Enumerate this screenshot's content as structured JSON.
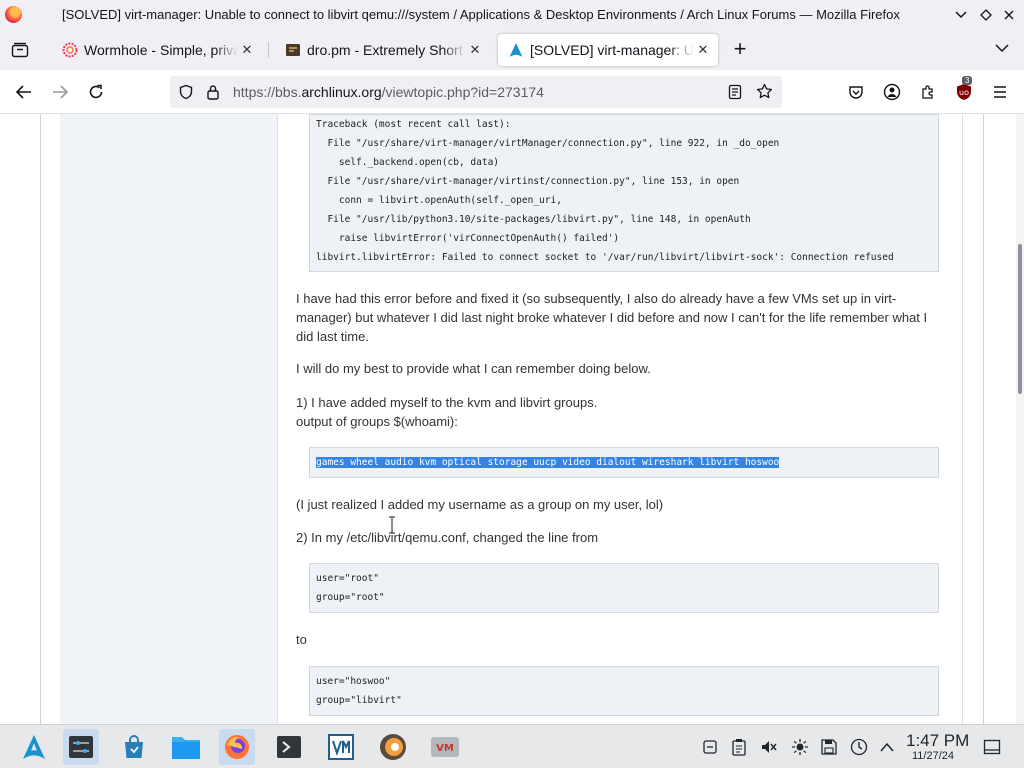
{
  "window": {
    "title": "[SOLVED] virt-manager: Unable to connect to libvirt qemu:///system / Applications & Desktop Environments / Arch Linux Forums — Mozilla Firefox"
  },
  "tabs": [
    {
      "label": "Wormhole - Simple, private file sharing",
      "favicon": "wormhole-icon",
      "active": false
    },
    {
      "label": "dro.pm - Extremely Short URL",
      "favicon": "dropm-icon",
      "active": false
    },
    {
      "label": "[SOLVED] virt-manager: Unable to connect",
      "favicon": "arch-icon",
      "active": true
    }
  ],
  "navbar": {
    "url_prefix": "https://bbs.",
    "url_domain": "archlinux.org",
    "url_path": "/viewtopic.php?id=273174",
    "extension_badge": "3"
  },
  "post": {
    "traceback": "Traceback (most recent call last):\n  File \"/usr/share/virt-manager/virtManager/connection.py\", line 922, in _do_open\n    self._backend.open(cb, data)\n  File \"/usr/share/virt-manager/virtinst/connection.py\", line 153, in open\n    conn = libvirt.openAuth(self._open_uri,\n  File \"/usr/lib/python3.10/site-packages/libvirt.py\", line 148, in openAuth\n    raise libvirtError('virConnectOpenAuth() failed')\nlibvirt.libvirtError: Failed to connect socket to '/var/run/libvirt/libvirt-sock': Connection refused",
    "para1": "I have had this error before and fixed it (so subsequently, I also do already have a few VMs set up in virt-manager) but whatever I did last night broke whatever I did before and now I can't  for the life remember what I did last time.",
    "para2": "I will do my best to provide what I can remember doing below.",
    "step1_line1": "1) I have added myself to the kvm and libvirt groups.",
    "step1_line2": "output of groups $(whoami):",
    "groups_output": "games wheel audio kvm optical storage uucp video dialout wireshark libvirt hoswoo",
    "para3": "(I just realized I added my username as a group on my user, lol)",
    "step2": "2) In my /etc/libvirt/qemu.conf, changed the line from",
    "code_from": "user=\"root\"\ngroup=\"root\"",
    "to_word": "to",
    "code_to": "user=\"hoswoo\"\ngroup=\"libvirt\""
  },
  "taskbar": {
    "time": "1:47 PM",
    "date": "11/27/24",
    "apps": [
      "arch-launcher-icon",
      "system-settings-icon",
      "discover-store-icon",
      "file-manager-icon",
      "firefox-icon",
      "konsole-icon",
      "virt-manager-icon",
      "blender-icon",
      "vm-icon"
    ]
  },
  "colors": {
    "selection": "#3584e4",
    "codebox_bg": "#eef1f5",
    "arch_blue": "#1793d1"
  }
}
